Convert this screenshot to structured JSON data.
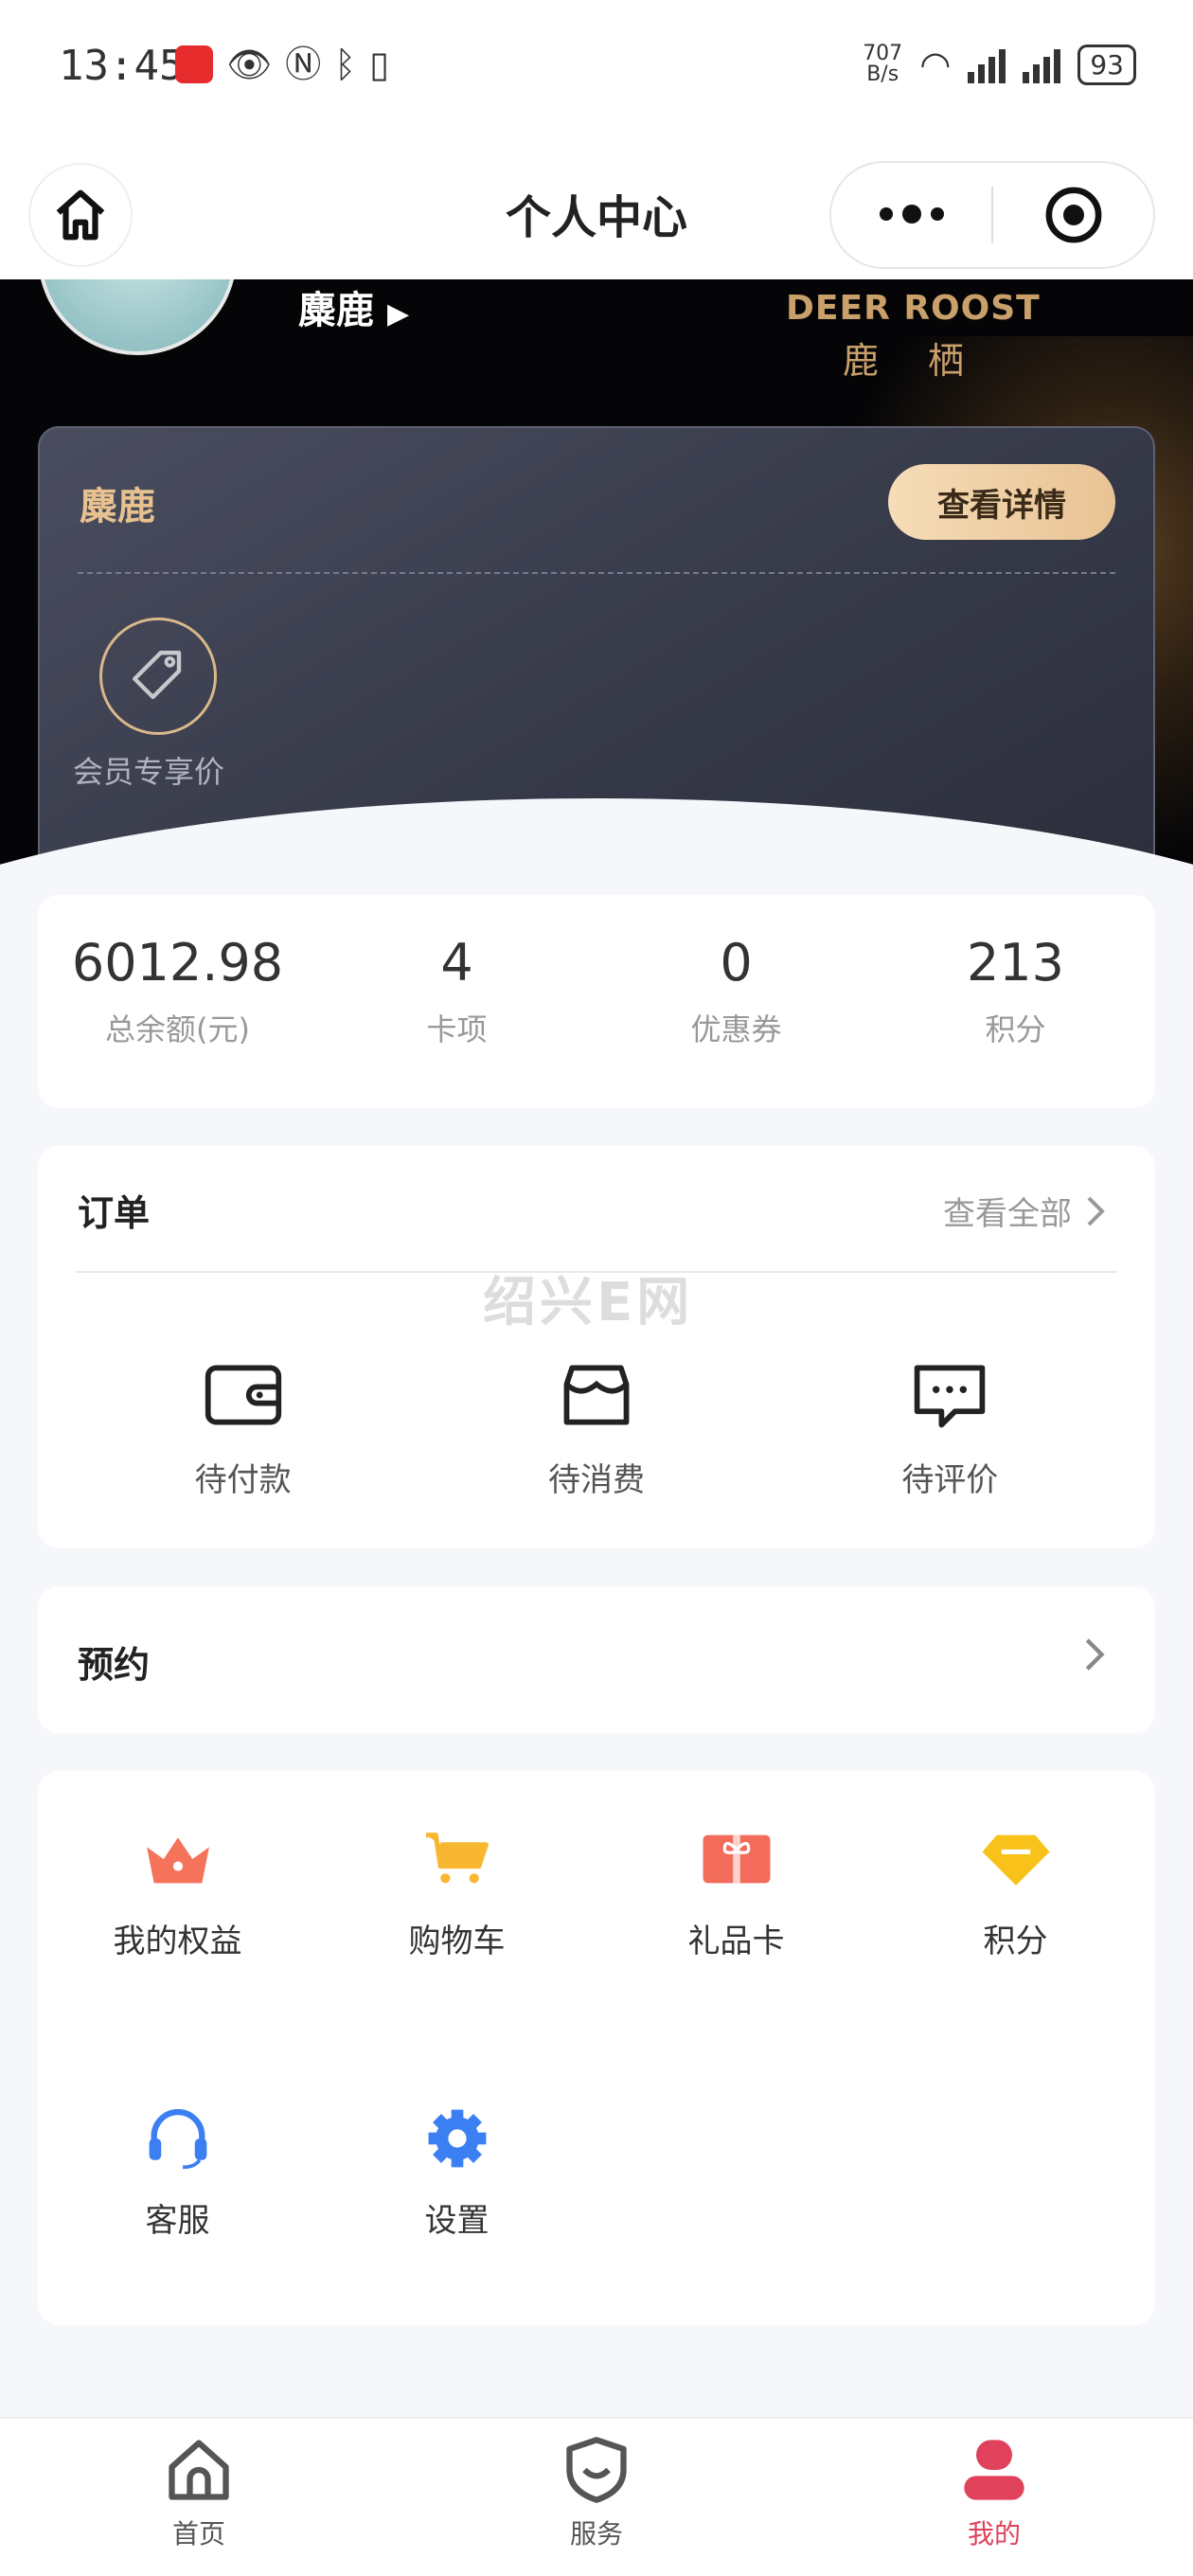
{
  "status_bar": {
    "time": "13:45",
    "net_speed_value": "707",
    "net_speed_unit": "B/s",
    "battery": "93"
  },
  "navbar": {
    "title": "个人中心"
  },
  "profile": {
    "username": "麋鹿",
    "brand_en": "DEER ROOST",
    "brand_cn": "鹿 栖"
  },
  "member_card": {
    "name": "麋鹿",
    "detail_button": "查看详情",
    "perk_label": "会员专享价"
  },
  "stats": [
    {
      "value": "6012.98",
      "label": "总余额(元)"
    },
    {
      "value": "4",
      "label": "卡项"
    },
    {
      "value": "0",
      "label": "优惠券"
    },
    {
      "value": "213",
      "label": "积分"
    }
  ],
  "orders": {
    "title": "订单",
    "view_all": "查看全部",
    "watermark": "绍兴E网",
    "items": [
      {
        "label": "待付款",
        "icon": "wallet-icon"
      },
      {
        "label": "待消费",
        "icon": "store-icon"
      },
      {
        "label": "待评价",
        "icon": "comment-icon"
      }
    ]
  },
  "appointment": {
    "title": "预约"
  },
  "services": {
    "items": [
      {
        "label": "我的权益",
        "icon": "crown-icon",
        "color": "#f5735a"
      },
      {
        "label": "购物车",
        "icon": "cart-icon",
        "color": "#f7b731"
      },
      {
        "label": "礼品卡",
        "icon": "gift-card-icon",
        "color": "#f26b5b"
      },
      {
        "label": "积分",
        "icon": "diamond-icon",
        "color": "#f9c21a"
      },
      {
        "label": "客服",
        "icon": "headset-icon",
        "color": "#3c7ff2"
      },
      {
        "label": "设置",
        "icon": "gear-icon",
        "color": "#3c7ff2"
      }
    ]
  },
  "tabbar": {
    "items": [
      {
        "label": "首页",
        "icon": "home-icon",
        "active": false
      },
      {
        "label": "服务",
        "icon": "shield-icon",
        "active": false
      },
      {
        "label": "我的",
        "icon": "user-icon",
        "active": true
      }
    ],
    "active_color": "#e0415b"
  }
}
